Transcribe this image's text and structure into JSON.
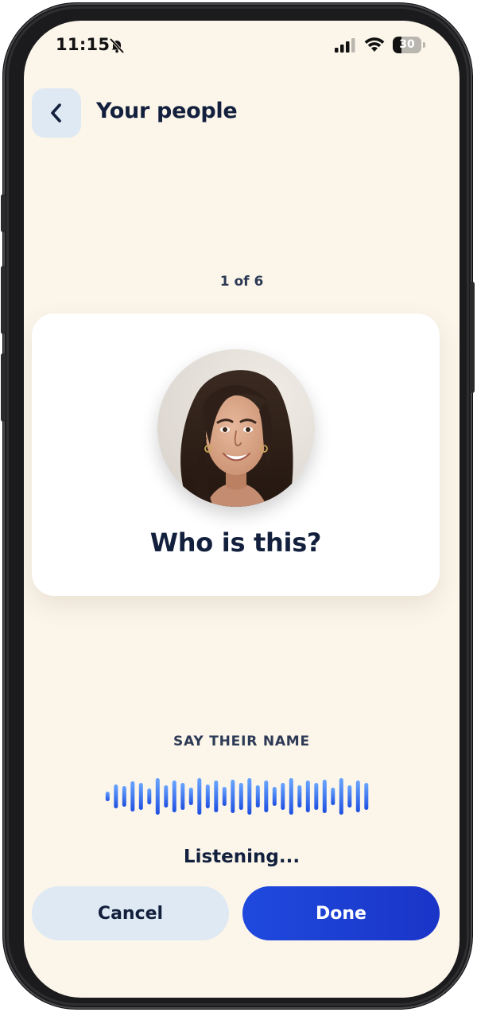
{
  "status_bar": {
    "time": "11:15",
    "silent_icon": "bell-slash-icon",
    "battery_level": 30,
    "battery_text": "30"
  },
  "header": {
    "back_icon": "chevron-left-icon",
    "title": "Your people"
  },
  "progress": {
    "counter": "1 of 6",
    "current": 1,
    "total": 6
  },
  "card": {
    "photo": "portrait-photo",
    "question": "Who is this?"
  },
  "voice": {
    "prompt": "SAY THEIR NAME",
    "waveform_icon": "waveform",
    "status": "Listening..."
  },
  "actions": {
    "cancel_label": "Cancel",
    "done_label": "Done"
  },
  "colors": {
    "background": "#fbf5ea",
    "text_primary": "#13203d",
    "accent": "#1f49dd",
    "secondary_button": "#dfe9f3",
    "wave_top": "#6aa6ff",
    "wave_bottom": "#1e4fe0"
  }
}
